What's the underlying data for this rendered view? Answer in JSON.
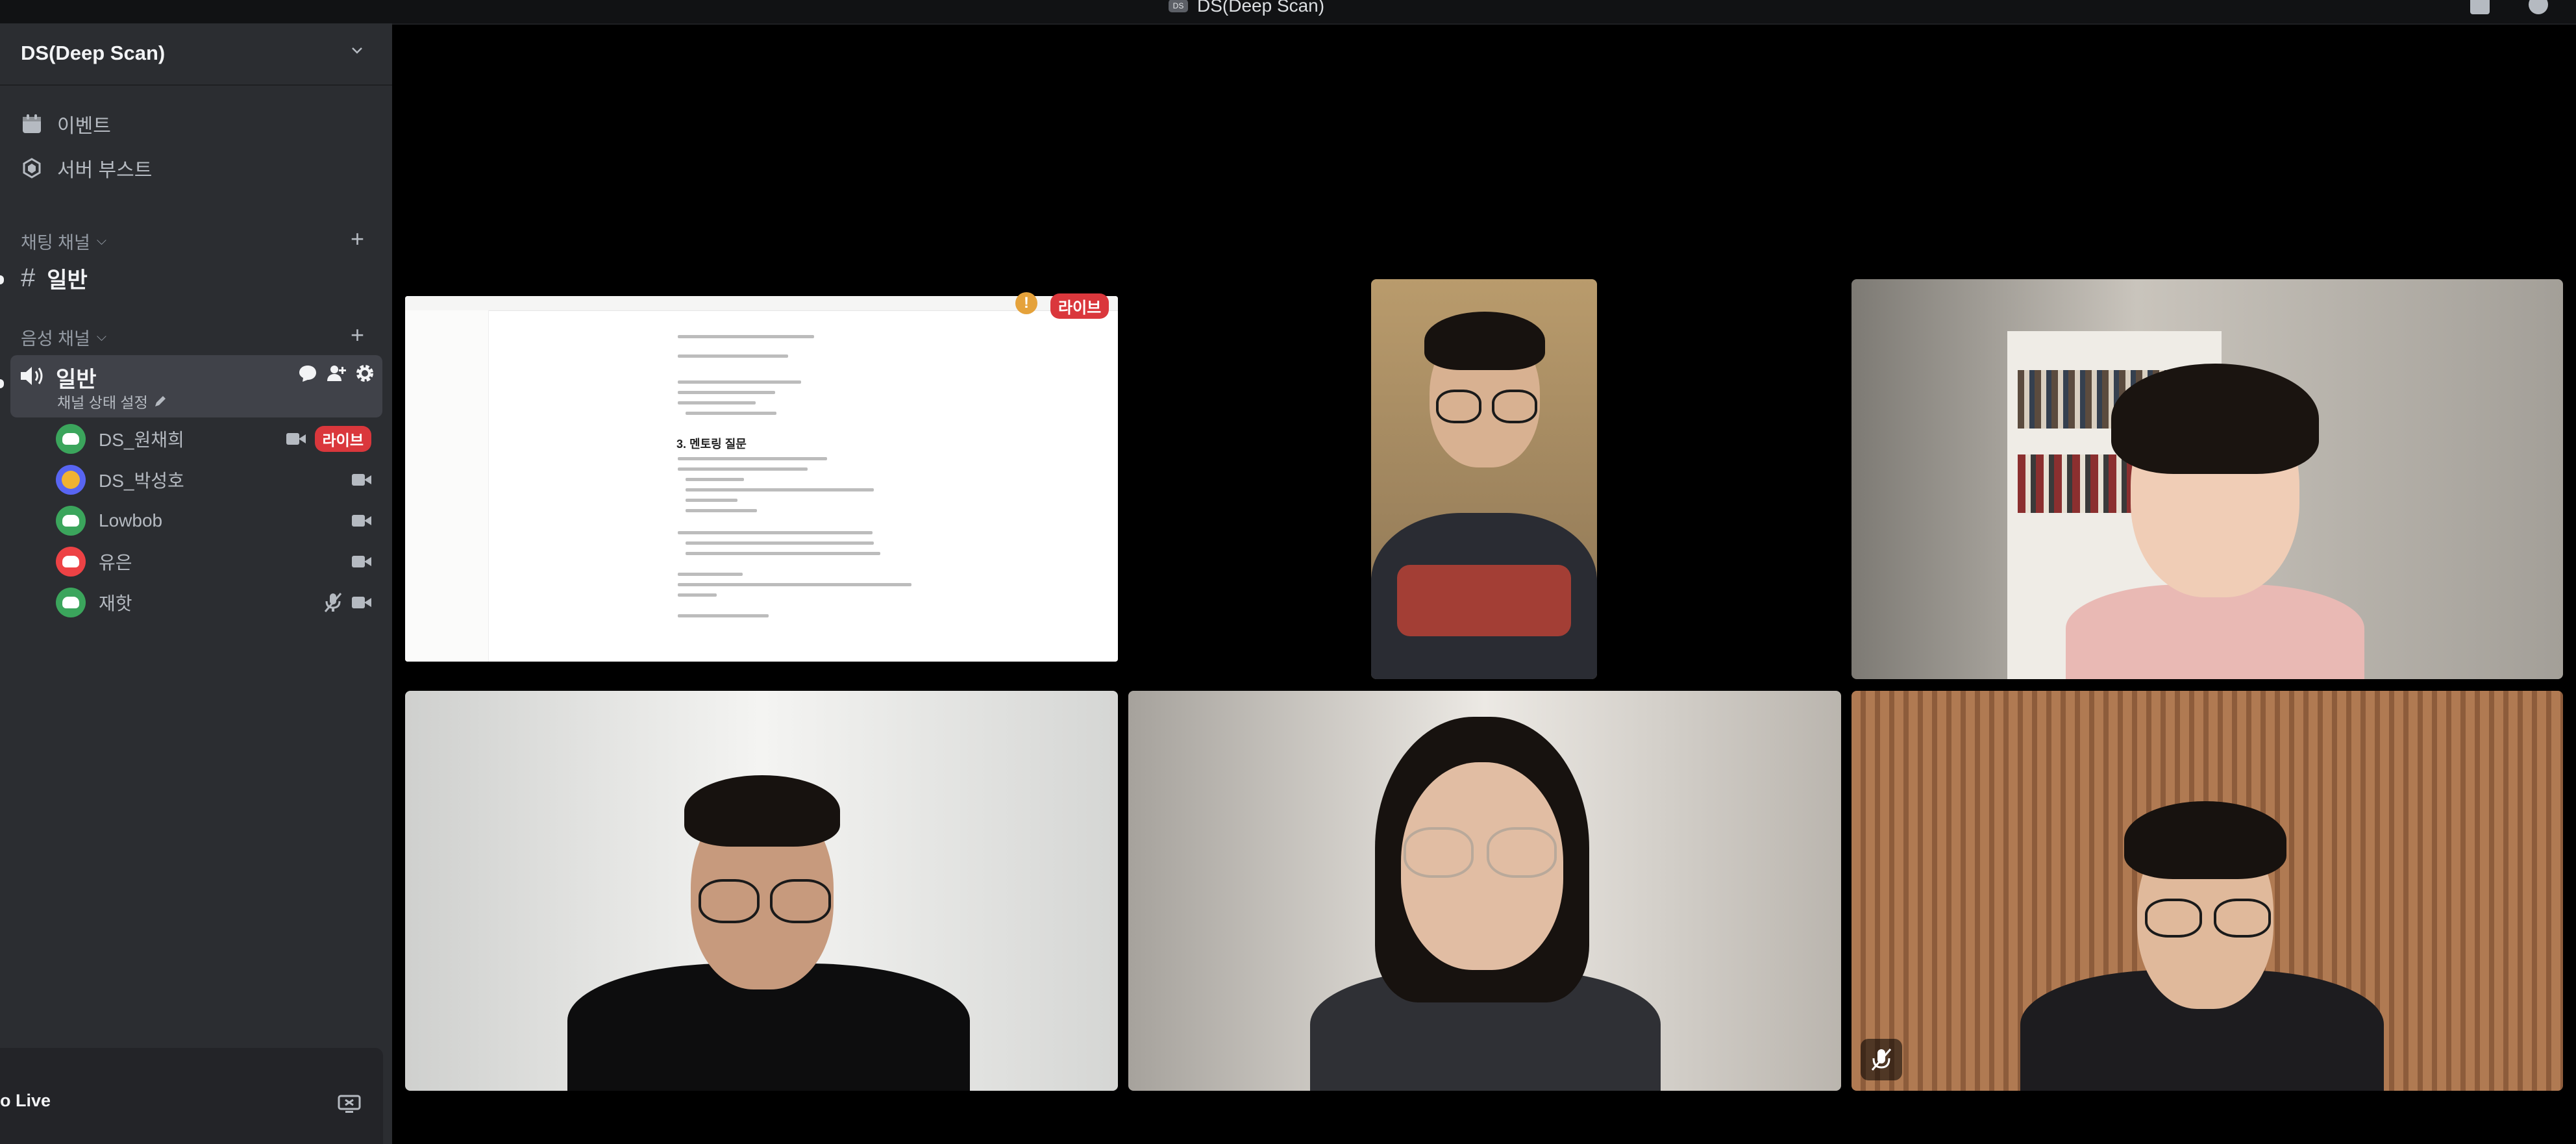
{
  "window": {
    "title": "DS(Deep Scan)",
    "server_icon_text": "DS"
  },
  "sidebar": {
    "server_name": "DS(Deep Scan)",
    "top_items": [
      {
        "label": "이벤트",
        "icon": "calendar-icon"
      },
      {
        "label": "서버 부스트",
        "icon": "boost-icon"
      }
    ],
    "text_category": "채팅 채널",
    "text_channels": [
      {
        "label": "일반",
        "icon": "hash-icon"
      }
    ],
    "voice_category": "음성 채널",
    "voice_channel": {
      "label": "일반",
      "status_placeholder": "채널 상태 설정"
    },
    "members": [
      {
        "name": "DS_원채희",
        "avatar_color": "#3ba55c",
        "camera": true,
        "live": true,
        "mic_muted": false
      },
      {
        "name": "DS_박성호",
        "avatar_color": "#f0b232",
        "camera": true,
        "live": false,
        "mic_muted": false
      },
      {
        "name": "Lowbob",
        "avatar_color": "#3ba55c",
        "camera": true,
        "live": false,
        "mic_muted": false
      },
      {
        "name": "유은",
        "avatar_color": "#ed4245",
        "camera": false,
        "live": false,
        "mic_muted": false
      },
      {
        "name": "재핫",
        "avatar_color": "#3ba55c",
        "camera": true,
        "live": false,
        "mic_muted": true
      }
    ],
    "live_badge": "라이브",
    "bottom_label": "o Live"
  },
  "stage": {
    "screen_share": {
      "live_badge": "라이브",
      "warning": "!",
      "heading": "3. 멘토링 질문"
    }
  },
  "colors": {
    "sidebar_bg": "#2b2d31",
    "selected_bg": "#404249",
    "live_red": "#da373c",
    "stage_bg": "#000000"
  }
}
